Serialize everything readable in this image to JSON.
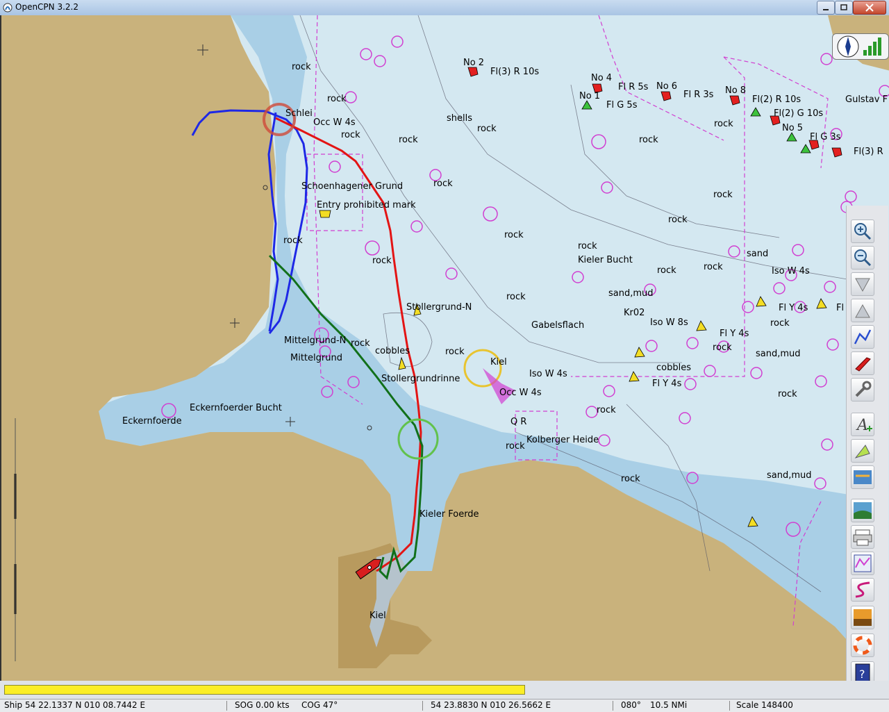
{
  "window": {
    "title": "OpenCPN 3.2.2",
    "icon": "opencpn-app-icon",
    "controls": [
      "minimize-icon",
      "maximize-icon",
      "close-icon"
    ]
  },
  "chart": {
    "labels": [
      "rock",
      "Schlei",
      "Occ W 4s",
      "Schoenhagener Grund",
      "Entry prohibited mark",
      "shells",
      "No 2",
      "Fl(3) R 10s",
      "No 4",
      "Fl R 5s",
      "No 6",
      "Fl R 3s",
      "No 1",
      "Fl G 5s",
      "No 8",
      "Fl(2) R 10s",
      "Fl(2) G 10s",
      "No 5",
      "Fl G 3s",
      "Fl(3) R",
      "Gulstav F",
      "Kieler Bucht",
      "sand,mud",
      "sand",
      "Iso W 4s",
      "Fl Y 4s",
      "Fl",
      "Stollergrund-N",
      "Gabelsflach",
      "Kr02",
      "Iso W 8s",
      "Fl Y 4s",
      "Mittelgrund-N",
      "Mittelgrund",
      "cobbles",
      "Kiel",
      "Stollergrundrinne",
      "Iso W 4s",
      "Occ W 4s",
      "cobbles",
      "Fl Y 4s",
      "Eckernfoerder Bucht",
      "Eckernfoerde",
      "Q R",
      "Kolberger Heide",
      "Kieler Foerde",
      "Kiel",
      "sand,mud"
    ]
  },
  "compass": {
    "icons": [
      "north-arrow-icon",
      "signal-strength-icon"
    ]
  },
  "toolbar": {
    "tools": [
      "zoom-in-icon",
      "zoom-out-icon",
      "scale-down-icon",
      "scale-up-icon",
      "route-icon",
      "ship-follow-icon",
      "settings-wrench-icon",
      "text-icon",
      "tide-icon",
      "current-icon",
      "route-manager-icon",
      "print-icon",
      "track-icon",
      "tracks-icon",
      "color-scheme-icon",
      "mob-icon",
      "help-icon"
    ]
  },
  "progress": {
    "fraction": 0.59
  },
  "status": {
    "ship": "Ship 54 22.1337 N   010 08.7442 E",
    "sog": "SOG 0.00 kts",
    "cog": "COG 47°",
    "cursor": "54 23.8830 N   010 26.5662 E",
    "bearing": "080°",
    "distance": "10.5 NMi",
    "scale": "Scale 148400"
  }
}
